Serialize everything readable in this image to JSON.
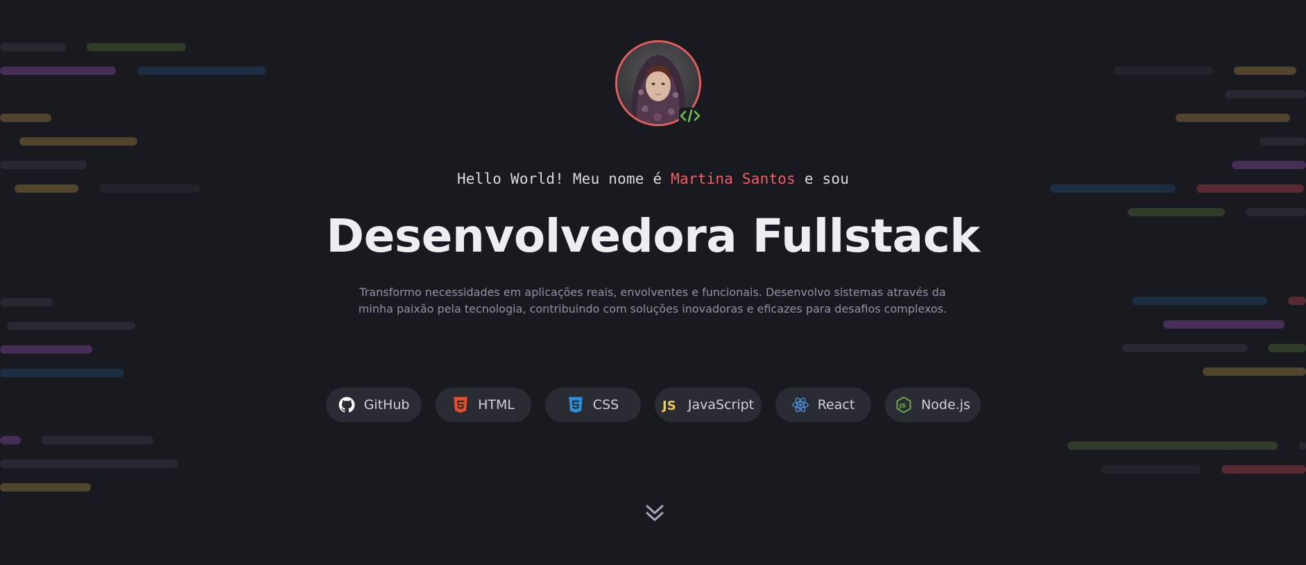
{
  "hero": {
    "greeting_prefix": "Hello World! Meu nome é ",
    "name": "Martina Santos",
    "greeting_suffix": " e sou",
    "headline": "Desenvolvedora Fullstack",
    "description": "Transformo necessidades em aplicações reais, envolventes e funcionais. Desenvolvo sistemas através da minha paixão pela tecnologia, contribuindo com soluções inovadoras e eficazes para desafios complexos."
  },
  "tech": [
    {
      "label": "GitHub",
      "icon": "github-icon",
      "color": "#ffffff"
    },
    {
      "label": "HTML",
      "icon": "html5-icon",
      "color": "#e34f26"
    },
    {
      "label": "CSS",
      "icon": "css3-icon",
      "color": "#2f8fdd"
    },
    {
      "label": "JavaScript",
      "icon": "javascript-icon",
      "color": "#f0c94f"
    },
    {
      "label": "React",
      "icon": "react-icon",
      "color": "#4a8fe0"
    },
    {
      "label": "Node.js",
      "icon": "nodejs-icon",
      "color": "#74b548"
    }
  ],
  "colors": {
    "background": "#191a1f",
    "accent": "#ef6063",
    "code_badge": "#6fc34b",
    "headline": "#eceef2",
    "muted_text": "#8f94a4"
  },
  "icons": {
    "avatar_badge": "code-brackets-icon",
    "scroll": "double-chevron-down-icon"
  }
}
